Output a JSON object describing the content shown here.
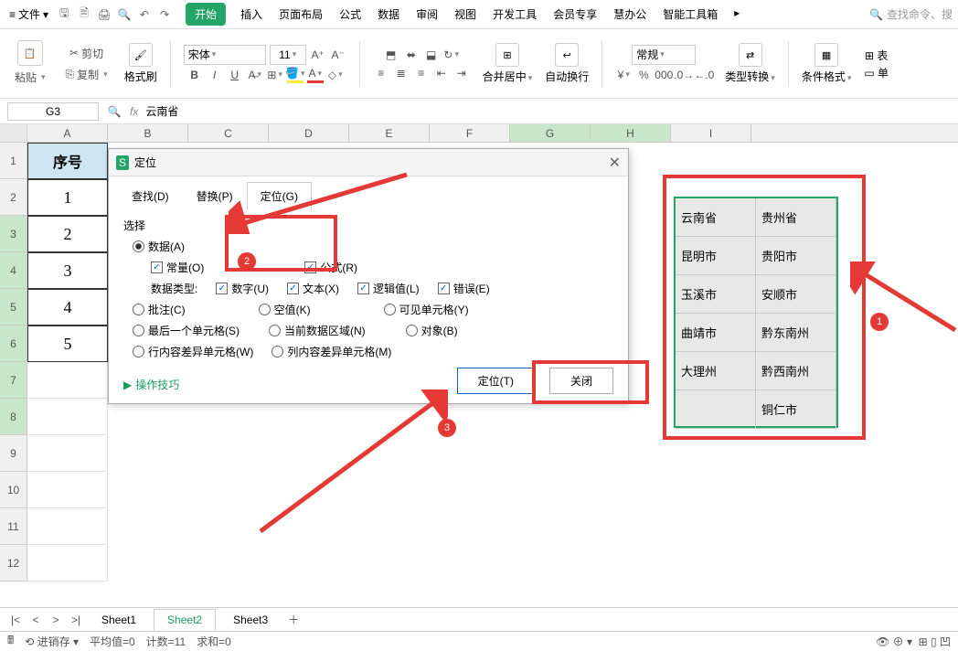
{
  "menu": {
    "file": "文件",
    "tabs": [
      "开始",
      "插入",
      "页面布局",
      "公式",
      "数据",
      "审阅",
      "视图",
      "开发工具",
      "会员专享",
      "慧办公",
      "智能工具箱"
    ],
    "search": "查找命令、搜"
  },
  "ribbon": {
    "clip": {
      "cut": "剪切",
      "copy": "复制",
      "paste": "粘贴",
      "fmt": "格式刷"
    },
    "font": {
      "name": "宋体",
      "size": "11"
    },
    "merge": "合并居中",
    "wrap": "自动换行",
    "numfmt": "常规",
    "typeconv": "类型转换",
    "condfmt": "条件格式",
    "table": "表",
    "single": "单"
  },
  "ref": {
    "cell": "G3",
    "formula": "云南省"
  },
  "cols": [
    "A",
    "B",
    "C",
    "D",
    "E",
    "F",
    "G",
    "H",
    "I"
  ],
  "rownums": [
    "1",
    "2",
    "3",
    "4",
    "5",
    "6",
    "7",
    "8",
    "9",
    "10",
    "11",
    "12"
  ],
  "colA": {
    "hdr": "序号",
    "vals": [
      "1",
      "2",
      "3",
      "4",
      "5"
    ]
  },
  "data_block": [
    [
      "云南省",
      "贵州省"
    ],
    [
      "昆明市",
      "贵阳市"
    ],
    [
      "玉溪市",
      "安顺市"
    ],
    [
      "曲靖市",
      "黔东南州"
    ],
    [
      "大理州",
      "黔西南州"
    ],
    [
      "",
      "铜仁市"
    ]
  ],
  "dialog": {
    "title": "定位",
    "tabs": {
      "find": "查找(D)",
      "replace": "替换(P)",
      "goto": "定位(G)"
    },
    "select": "选择",
    "data": "数据(A)",
    "const": "常量(O)",
    "formula": "公式(R)",
    "dtype": "数据类型:",
    "num": "数字(U)",
    "text": "文本(X)",
    "logic": "逻辑值(L)",
    "err": "错误(E)",
    "comment": "批注(C)",
    "blank": "空值(K)",
    "visible": "可见单元格(Y)",
    "last": "最后一个单元格(S)",
    "region": "当前数据区域(N)",
    "object": "对象(B)",
    "rowdiff": "行内容差异单元格(W)",
    "coldiff": "列内容差异单元格(M)",
    "tips": "操作技巧",
    "go": "定位(T)",
    "close": "关闭"
  },
  "badges": {
    "b1": "1",
    "b2": "2",
    "b3": "3"
  },
  "sheets": [
    "Sheet1",
    "Sheet2",
    "Sheet3"
  ],
  "status": {
    "undo": "进销存",
    "avg": "平均值=0",
    "cnt": "计数=11",
    "sum": "求和=0"
  }
}
